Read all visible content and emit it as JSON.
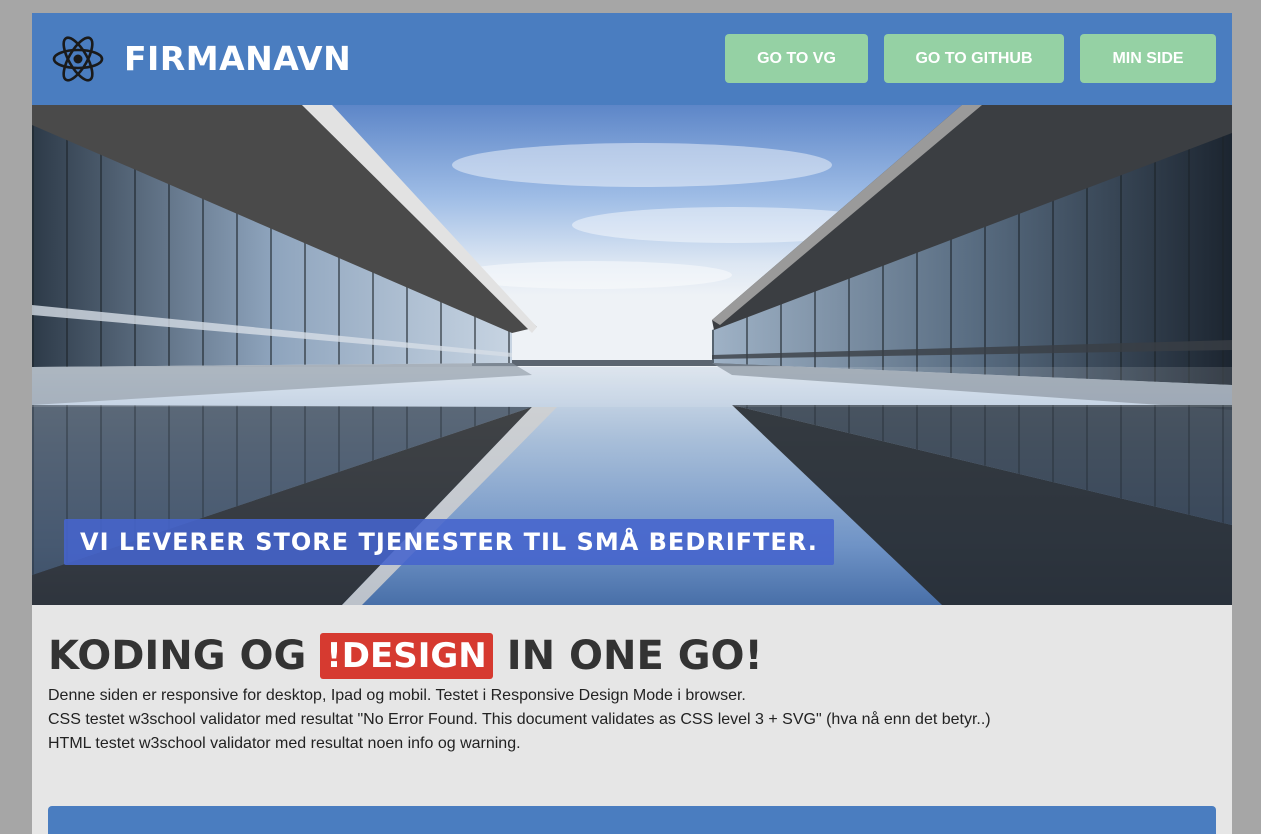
{
  "header": {
    "brand": "FIRMANAVN",
    "nav": [
      {
        "label": "GO TO VG"
      },
      {
        "label": "GO TO GITHUB"
      },
      {
        "label": "MIN SIDE"
      }
    ]
  },
  "hero": {
    "tagline": "VI LEVERER STORE TJENESTER TIL SMÅ BEDRIFTER."
  },
  "main": {
    "heading_before": "KODING OG",
    "heading_badge": "!DESIGN",
    "heading_after": "IN ONE GO!",
    "lines": [
      "Denne siden er responsive for desktop, Ipad og mobil. Testet i Responsive Design Mode i browser.",
      "CSS testet w3school validator med resultat \"No Error Found. This document validates as CSS level 3 + SVG\" (hva nå enn det betyr..)",
      "HTML testet w3school validator med resultat noen info og warning."
    ]
  },
  "colors": {
    "header": "#4a7dc0",
    "nav_button": "#95d1a4",
    "badge": "#d63a30",
    "background": "#e6e6e6"
  },
  "icons": [
    "atom-logo-icon"
  ]
}
